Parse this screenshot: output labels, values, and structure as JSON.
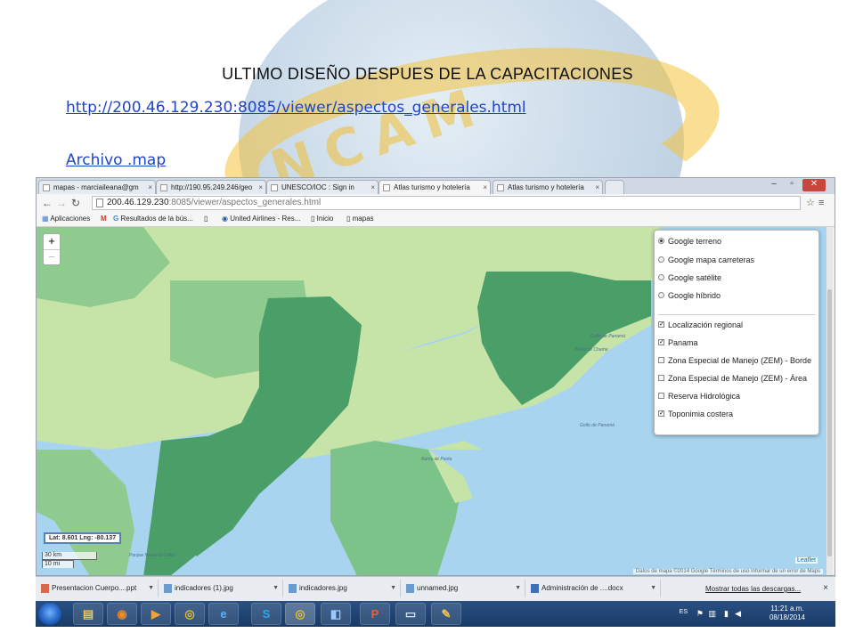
{
  "slide": {
    "title": "ULTIMO DISEÑO DESPUES DE LA CAPACITACIONES",
    "link_viewer": "http://200.46.129.230:8085/viewer/aspectos_generales.html",
    "link_map": "Archivo .map",
    "watermark_letters": "NCAM"
  },
  "browser": {
    "tabs": [
      {
        "label": "mapas - marciaileana@gm"
      },
      {
        "label": "http://190.95.249.246/geo"
      },
      {
        "label": "UNESCO/IOC : Sign in"
      },
      {
        "label": "Atlas turismo y hotelería",
        "active": true
      },
      {
        "label": "Atlas turismo y hotelería"
      }
    ],
    "url_host": "200.46.129.230",
    "url_path": ":8085/viewer/aspectos_generales.html",
    "bookmarks": [
      "Aplicaciones",
      "Resultados de la bús...",
      "United Airlines - Res...",
      "Inicio",
      "mapas"
    ]
  },
  "map": {
    "zoom_in": "+",
    "zoom_out": "−",
    "coords": "Lat: 8.601 Lng: -80.137",
    "scale_km": "30 km",
    "scale_mi": "10 mi",
    "attribution": "Datos de mapa ©2014 Google   Términos de uso   Informar de un error de Maps",
    "leaflet": "Leaflet",
    "labels": [
      "Golfo de Panamá",
      "Bahía de Chame",
      "Golfo de Panamá",
      "Bahía de Parita",
      "Parque Nacional Coiba"
    ],
    "base_layers": [
      {
        "label": "Google terreno",
        "selected": true
      },
      {
        "label": "Google mapa carreteras",
        "selected": false
      },
      {
        "label": "Google satélite",
        "selected": false
      },
      {
        "label": "Google híbrido",
        "selected": false
      }
    ],
    "overlays": [
      {
        "label": "Localización regional",
        "checked": true
      },
      {
        "label": "Panama",
        "checked": true
      },
      {
        "label": "Zona Especial de Manejo (ZEM) - Borde",
        "checked": false
      },
      {
        "label": "Zona Especial de Manejo (ZEM) - Área",
        "checked": false
      },
      {
        "label": "Reserva Hidrológica",
        "checked": false
      },
      {
        "label": "Toponimia costera",
        "checked": true
      }
    ],
    "colors": {
      "sea": "#a9d4ef",
      "light_green": "#c6e4a8",
      "mid_green": "#7cc38a",
      "dark_green": "#4a9e68"
    }
  },
  "downloads": {
    "items": [
      "Presentacion Cuerpo....ppt",
      "indicadores (1).jpg",
      "indicadores.jpg",
      "unnamed.jpg",
      "Administración de ....docx"
    ],
    "show_all": "Mostrar todas las descargas...",
    "close": "×"
  },
  "taskbar": {
    "lang": "ES",
    "time": "11:21 a.m.",
    "date": "08/18/2014",
    "apps": [
      "explorer-icon",
      "firefox-icon",
      "media-player-icon",
      "chrome-icon",
      "ie-icon",
      "skype-icon",
      "chrome-icon",
      "app-icon",
      "powerpoint-icon",
      "window-icon",
      "paint-icon"
    ]
  }
}
